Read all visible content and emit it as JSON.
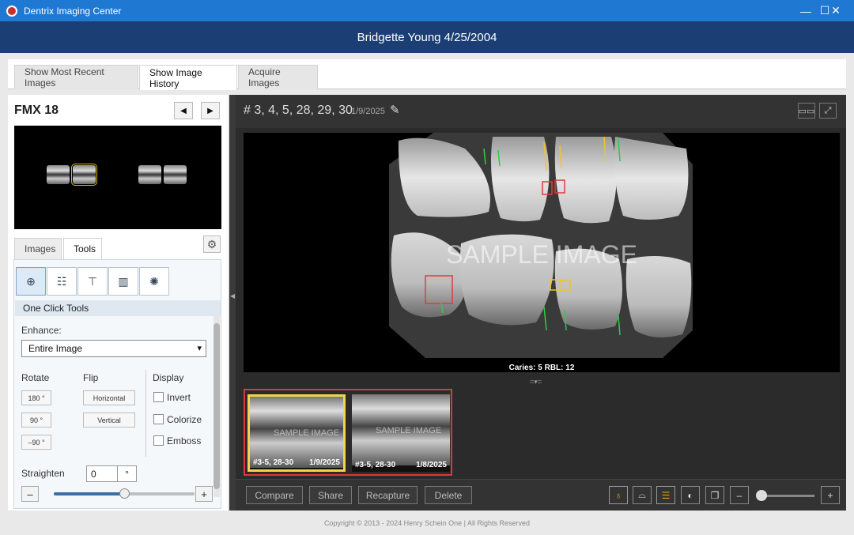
{
  "window": {
    "app_title": "Dentrix Imaging Center",
    "minimize_glyph": "—",
    "maximize_glyph": "☐",
    "close_glyph": "✕"
  },
  "patient_header": "Bridgette Young 4/25/2004",
  "tabs": [
    {
      "label": "Show Most Recent Images",
      "active": false
    },
    {
      "label": "Show Image History",
      "active": true
    },
    {
      "label": "Acquire Images",
      "active": false
    }
  ],
  "left_panel": {
    "series_title": "FMX 18",
    "prev_glyph": "◀",
    "next_glyph": "▶",
    "subtabs": [
      {
        "label": "Images",
        "active": false
      },
      {
        "label": "Tools",
        "active": true
      }
    ],
    "gear_glyph": "⚙",
    "tool_icons": [
      "selection-tool-icon",
      "annotation-icon",
      "measure-icon",
      "histogram-icon",
      "light-icon"
    ],
    "one_click_tools": "One Click Tools",
    "enhance_label": "Enhance:",
    "enhance_value": "Entire Image",
    "rotate_label": "Rotate",
    "rotate_buttons": [
      "180 °",
      "90 °",
      "–90 °"
    ],
    "flip_label": "Flip",
    "flip_buttons": [
      "Horizontal",
      "Vertical"
    ],
    "display_label": "Display",
    "display_options": [
      "Invert",
      "Colorize",
      "Emboss"
    ],
    "straighten_label": "Straighten",
    "straighten_value": "0",
    "degree_symbol": "°",
    "straighten_level_percent": 50,
    "minus": "–",
    "plus": "+"
  },
  "viewer": {
    "teeth_title": "# 3, 4, 5, 28, 29, 30",
    "date": "1/9/2025",
    "pencil_glyph": "✎",
    "watermark": "SAMPLE IMAGE",
    "caption": "Caries: 5 RBL: 12",
    "strip_handle": "=▾=",
    "thumbnails": [
      {
        "teeth": "#3-5, 28-30",
        "date": "1/9/2025",
        "watermark": "SAMPLE IMAGE",
        "selected": true
      },
      {
        "teeth": "#3-5, 28-30",
        "date": "1/8/2025",
        "watermark": "SAMPLE IMAGE",
        "selected": false
      }
    ],
    "buttons": [
      "Compare",
      "Share",
      "Recapture",
      "Delete"
    ],
    "zoom_minus": "–",
    "zoom_plus": "+"
  },
  "footer": "Copyright © 2013 - 2024 Henry Schein One | All Rights Reserved",
  "colors": {
    "titlebar": "#1f78d1",
    "header": "#1b3f74",
    "caries_box": "#e23a3a",
    "rbl_box": "#f1c232",
    "selection_border": "#d83a3a"
  }
}
